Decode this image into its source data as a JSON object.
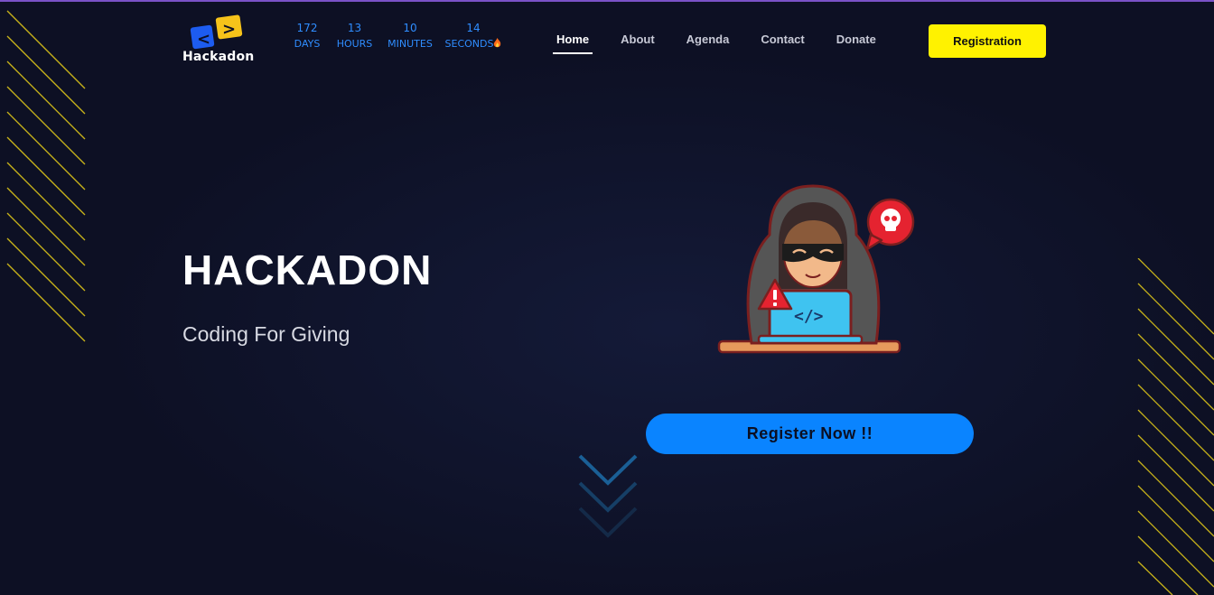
{
  "brand": {
    "name": "Hackadon",
    "logo_left": "<",
    "logo_right": ">"
  },
  "countdown": [
    {
      "value": "172",
      "unit": "DAYS"
    },
    {
      "value": "13",
      "unit": "HOURS"
    },
    {
      "value": "10",
      "unit": "MINUTES"
    },
    {
      "value": "14",
      "unit": "SECONDS"
    }
  ],
  "nav": {
    "items": [
      "Home",
      "About",
      "Agenda",
      "Contact",
      "Donate"
    ],
    "active": "Home"
  },
  "header": {
    "registration_label": "Registration"
  },
  "hero": {
    "title": "HACKADON",
    "subtitle": "Coding For Giving",
    "cta_label": "Register Now !!"
  },
  "colors": {
    "background": "#0d1024",
    "accent_yellow": "#fff200",
    "accent_blue": "#0a84ff",
    "countdown_blue": "#2f8dff",
    "top_strip": "#7a52c7"
  },
  "icons": {
    "hacker": "hacker-laptop-illustration",
    "alert": "warning-icon",
    "skull": "skull-bubble-icon",
    "scroll": "chevrons-down-icon"
  }
}
